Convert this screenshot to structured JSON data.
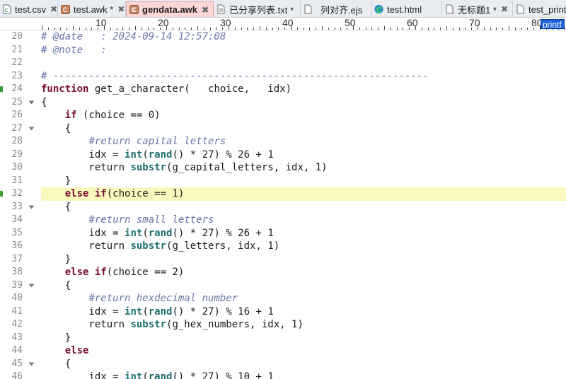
{
  "tabs": [
    {
      "label": "test.csv",
      "icon": "csv-file-icon",
      "active": false
    },
    {
      "label": "test.awk *",
      "icon": "awk-file-icon",
      "active": false
    },
    {
      "label": "gendata.awk",
      "icon": "awk-file-icon",
      "active": true
    },
    {
      "label": "已分享列表.txt *",
      "icon": "text-file-icon",
      "active": false
    },
    {
      "label": "列对齐.ejs",
      "icon": "blank-file-icon",
      "active": false
    },
    {
      "label": "test.html",
      "icon": "edge-browser-icon",
      "active": false
    },
    {
      "label": "无标题1 *",
      "icon": "blank-file-icon",
      "active": false
    },
    {
      "label": "test_print.e",
      "icon": "blank-file-icon",
      "active": false
    }
  ],
  "ruler": {
    "labels": [
      "10",
      "20",
      "30",
      "40",
      "50",
      "60",
      "70",
      "80"
    ],
    "function_tooltip": "printf"
  },
  "colors": {
    "comment": "#6b76a8",
    "keyword": "#7a0d35",
    "builtin": "#1e6f6f",
    "current_line": "#fbf8bd",
    "active_tab": "#ffd6d6"
  },
  "editor": {
    "lines": [
      {
        "n": "20",
        "tokens": [
          [
            "comment",
            "# @date   : 2024-09-14 12:57:08"
          ]
        ]
      },
      {
        "n": "21",
        "tokens": [
          [
            "comment",
            "# @note   :"
          ]
        ]
      },
      {
        "n": "22",
        "tokens": []
      },
      {
        "n": "23",
        "tokens": [
          [
            "comment",
            "# ---------------------------------------------------------------"
          ]
        ]
      },
      {
        "n": "24",
        "marker": true,
        "tokens": [
          [
            "keyword",
            "function"
          ],
          [
            "plain",
            " get_a_character(   choice,   idx)"
          ]
        ]
      },
      {
        "n": "25",
        "fold": true,
        "tokens": [
          [
            "plain",
            "{"
          ]
        ]
      },
      {
        "n": "26",
        "tokens": [
          [
            "plain",
            "    "
          ],
          [
            "keyword",
            "if"
          ],
          [
            "plain",
            " (choice == 0)"
          ]
        ]
      },
      {
        "n": "27",
        "fold": true,
        "tokens": [
          [
            "plain",
            "    {"
          ]
        ]
      },
      {
        "n": "28",
        "tokens": [
          [
            "plain",
            "        "
          ],
          [
            "comment",
            "#return capital letters"
          ]
        ]
      },
      {
        "n": "29",
        "tokens": [
          [
            "plain",
            "        idx = "
          ],
          [
            "builtin",
            "int"
          ],
          [
            "plain",
            "("
          ],
          [
            "builtin",
            "rand"
          ],
          [
            "plain",
            "() * 27) % 26 + 1"
          ]
        ]
      },
      {
        "n": "30",
        "tokens": [
          [
            "plain",
            "        return "
          ],
          [
            "builtin",
            "substr"
          ],
          [
            "plain",
            "(g_capital_letters, idx, 1)"
          ]
        ]
      },
      {
        "n": "31",
        "tokens": [
          [
            "plain",
            "    }"
          ]
        ]
      },
      {
        "n": "32",
        "marker": true,
        "highlight": true,
        "tokens": [
          [
            "plain",
            "    "
          ],
          [
            "keyword",
            "else if"
          ],
          [
            "plain",
            "(choice == 1)"
          ]
        ]
      },
      {
        "n": "33",
        "fold": true,
        "tokens": [
          [
            "plain",
            "    {"
          ]
        ]
      },
      {
        "n": "34",
        "tokens": [
          [
            "plain",
            "        "
          ],
          [
            "comment",
            "#return small letters"
          ]
        ]
      },
      {
        "n": "35",
        "tokens": [
          [
            "plain",
            "        idx = "
          ],
          [
            "builtin",
            "int"
          ],
          [
            "plain",
            "("
          ],
          [
            "builtin",
            "rand"
          ],
          [
            "plain",
            "() * 27) % 26 + 1"
          ]
        ]
      },
      {
        "n": "36",
        "tokens": [
          [
            "plain",
            "        return "
          ],
          [
            "builtin",
            "substr"
          ],
          [
            "plain",
            "(g_letters, idx, 1)"
          ]
        ]
      },
      {
        "n": "37",
        "tokens": [
          [
            "plain",
            "    }"
          ]
        ]
      },
      {
        "n": "38",
        "tokens": [
          [
            "plain",
            "    "
          ],
          [
            "keyword",
            "else if"
          ],
          [
            "plain",
            "(choice == 2)"
          ]
        ]
      },
      {
        "n": "39",
        "fold": true,
        "tokens": [
          [
            "plain",
            "    {"
          ]
        ]
      },
      {
        "n": "40",
        "tokens": [
          [
            "plain",
            "        "
          ],
          [
            "comment",
            "#return hexdecimal number"
          ]
        ]
      },
      {
        "n": "41",
        "tokens": [
          [
            "plain",
            "        idx = "
          ],
          [
            "builtin",
            "int"
          ],
          [
            "plain",
            "("
          ],
          [
            "builtin",
            "rand"
          ],
          [
            "plain",
            "() * 27) % 16 + 1"
          ]
        ]
      },
      {
        "n": "42",
        "tokens": [
          [
            "plain",
            "        return "
          ],
          [
            "builtin",
            "substr"
          ],
          [
            "plain",
            "(g_hex_numbers, idx, 1)"
          ]
        ]
      },
      {
        "n": "43",
        "tokens": [
          [
            "plain",
            "    }"
          ]
        ]
      },
      {
        "n": "44",
        "tokens": [
          [
            "plain",
            "    "
          ],
          [
            "keyword",
            "else"
          ]
        ]
      },
      {
        "n": "45",
        "fold": true,
        "tokens": [
          [
            "plain",
            "    {"
          ]
        ]
      },
      {
        "n": "46",
        "tokens": [
          [
            "plain",
            "        idx = "
          ],
          [
            "builtin",
            "int"
          ],
          [
            "plain",
            "("
          ],
          [
            "builtin",
            "rand"
          ],
          [
            "plain",
            "() * 27) % 10 + 1"
          ]
        ]
      }
    ]
  }
}
